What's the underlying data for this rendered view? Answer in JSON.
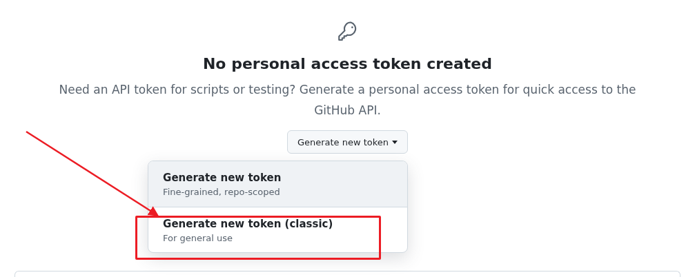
{
  "empty_state": {
    "title": "No personal access token created",
    "description": "Need an API token for scripts or testing? Generate a personal access token for quick access to the GitHub API."
  },
  "button": {
    "label": "Generate new token"
  },
  "menu": {
    "items": [
      {
        "title": "Generate new token",
        "subtitle": "Fine-grained, repo-scoped",
        "selected": true
      },
      {
        "title": "Generate new token (classic)",
        "subtitle": "For general use",
        "selected": false
      }
    ]
  }
}
